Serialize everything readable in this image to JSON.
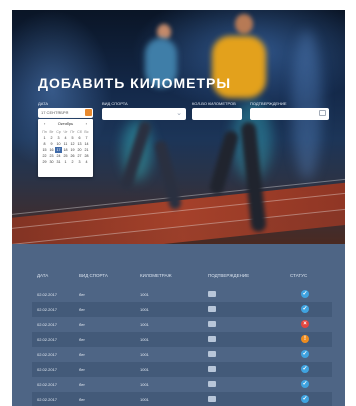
{
  "hero": {
    "title": "ДОБАВИТЬ КИЛОМЕТРЫ",
    "form": {
      "date_label": "ДАТА",
      "sport_label": "ВИД СПОРТА",
      "km_label": "КОЛ-ВО КИЛОМЕТРОВ",
      "proof_label": "ПОДТВЕРЖДЕНИЕ",
      "date_value": "17 СЕНТЯБРЯ"
    },
    "calendar": {
      "month": "Октябрь",
      "prev": "‹",
      "next": "›",
      "weekdays": [
        "Пн",
        "Вт",
        "Ср",
        "Чт",
        "Пт",
        "Сб",
        "Вс"
      ],
      "days": [
        "1",
        "2",
        "3",
        "4",
        "5",
        "6",
        "7",
        "8",
        "9",
        "10",
        "11",
        "12",
        "13",
        "14",
        "15",
        "16",
        "17",
        "18",
        "19",
        "20",
        "21",
        "22",
        "23",
        "24",
        "25",
        "26",
        "27",
        "28",
        "29",
        "30",
        "31",
        "1",
        "2",
        "3",
        "4"
      ],
      "selected_day": "17"
    }
  },
  "table": {
    "headers": [
      "ДАТА",
      "ВИД СПОРТА",
      "КИЛОМЕТРАЖ",
      "ПОДТВЕРЖДЕНИЕ",
      "СТАТУС"
    ],
    "rows": [
      {
        "date": "02.02.2017",
        "sport": "бег",
        "km": "1001",
        "status": "ok"
      },
      {
        "date": "02.02.2017",
        "sport": "бег",
        "km": "1001",
        "status": "ok"
      },
      {
        "date": "02.02.2017",
        "sport": "бег",
        "km": "1001",
        "status": "rejected"
      },
      {
        "date": "02.02.2017",
        "sport": "бег",
        "km": "1001",
        "status": "pending"
      },
      {
        "date": "02.02.2017",
        "sport": "бег",
        "km": "1001",
        "status": "ok"
      },
      {
        "date": "02.02.2017",
        "sport": "бег",
        "km": "1001",
        "status": "ok"
      },
      {
        "date": "02.02.2017",
        "sport": "бег",
        "km": "1001",
        "status": "ok"
      },
      {
        "date": "02.02.2017",
        "sport": "бег",
        "km": "1001",
        "status": "ok"
      }
    ]
  },
  "icons": {
    "calendar_button": "calendar-icon",
    "select_chevron": "chevron-down-icon",
    "proof_upload": "image-upload-icon",
    "status_ok": "check-circle-icon",
    "status_rejected": "x-circle-icon",
    "status_pending": "clock-circle-icon"
  },
  "colors": {
    "table_bg": "#4e6585",
    "row_alt": "#435a79",
    "accent_orange": "#e98a2e",
    "status_ok": "#3fa3e0",
    "status_rejected": "#e0463f",
    "status_pending": "#ee8c1f"
  }
}
